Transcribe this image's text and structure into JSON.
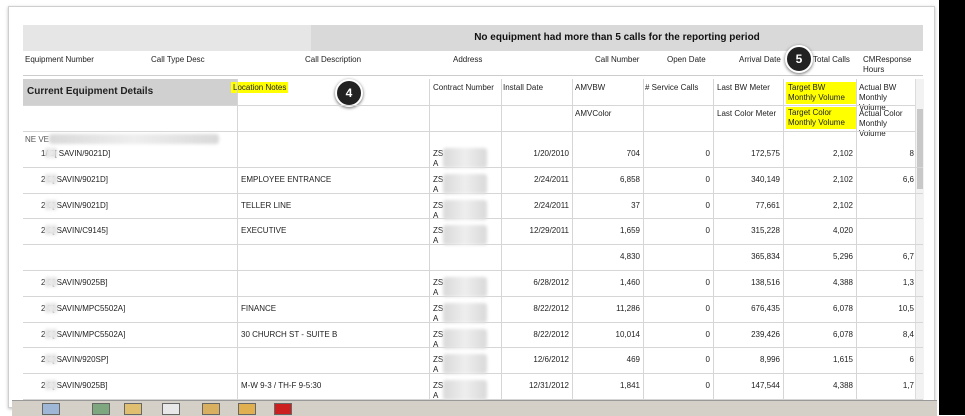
{
  "banner": {
    "message": "No equipment had more than 5 calls for the reporting period"
  },
  "call_columns": [
    "Equipment Number",
    "Call Type Desc",
    "Call Description",
    "Address",
    "Call Number",
    "Open Date",
    "Arrival Date",
    "Total Calls",
    "CMResponse Hours"
  ],
  "section": {
    "title": "Current Equipment Details"
  },
  "headers": {
    "location_notes": "Location Notes",
    "contract_number": "Contract Number",
    "install_date": "Install Date",
    "amv_bw": "AMVBW",
    "amv_color": "AMVColor",
    "service_calls": "# Service Calls",
    "last_bw": "Last BW Meter",
    "last_color": "Last Color Meter",
    "target_bw": "Target BW Monthly Volume",
    "target_color": "Target Color Monthly Volume",
    "actual_bw": "Actual BW Monthly Volume",
    "actual_color": "Actual Color Monthly Volume"
  },
  "badges": {
    "b4": "4",
    "b5": "5"
  },
  "address_group": "NE                                    VE",
  "rows": [
    {
      "equip": "1/   5[ SAVIN/9021D]",
      "notes": "",
      "contract": "ZS\nA",
      "install": "1/20/2010",
      "amv": "704",
      "calls": "0",
      "last_bw": "172,575",
      "target": "2,102",
      "actual": "8"
    },
    {
      "equip": "2   5[ SAVIN/9021D]",
      "notes": "EMPLOYEE ENTRANCE",
      "contract": "ZS\nA",
      "install": "2/24/2011",
      "amv": "6,858",
      "calls": "0",
      "last_bw": "340,149",
      "target": "2,102",
      "actual": "6,6"
    },
    {
      "equip": "2   6[ SAVIN/9021D]",
      "notes": "TELLER LINE",
      "contract": "ZS\nA",
      "install": "2/24/2011",
      "amv": "37",
      "calls": "0",
      "last_bw": "77,661",
      "target": "2,102",
      "actual": ""
    },
    {
      "equip": "2   1[ SAVIN/C9145]",
      "notes": "EXECUTIVE",
      "contract": "ZS\nA",
      "install": "12/29/2011",
      "amv": "1,659",
      "calls": "0",
      "last_bw": "315,228",
      "target": "4,020",
      "actual": ""
    },
    {
      "equip": "",
      "notes": "",
      "contract": "",
      "install": "",
      "amv": "4,830",
      "calls": "",
      "last_bw": "365,834",
      "target": "5,296",
      "actual": "6,7"
    },
    {
      "equip": "2   9[ SAVIN/9025B]",
      "notes": "",
      "contract": "ZS\nA",
      "install": "6/28/2012",
      "amv": "1,460",
      "calls": "0",
      "last_bw": "138,516",
      "target": "4,388",
      "actual": "1,3"
    },
    {
      "equip": "2   7[ SAVIN/MPC5502A]",
      "notes": "FINANCE",
      "contract": "ZS\nA",
      "install": "8/22/2012",
      "amv": "11,286",
      "calls": "0",
      "last_bw": "676,435",
      "target": "6,078",
      "actual": "10,5"
    },
    {
      "equip": "2   9[ SAVIN/MPC5502A]",
      "notes": "30 CHURCH ST - SUITE B",
      "contract": "ZS\nA",
      "install": "8/22/2012",
      "amv": "10,014",
      "calls": "0",
      "last_bw": "239,426",
      "target": "6,078",
      "actual": "8,4"
    },
    {
      "equip": "2   2[ SAVIN/920SP]",
      "notes": "",
      "contract": "ZS\nA",
      "install": "12/6/2012",
      "amv": "469",
      "calls": "0",
      "last_bw": "8,996",
      "target": "1,615",
      "actual": "6"
    },
    {
      "equip": "2   5[ SAVIN/9025B]",
      "notes": "M-W 9-3 / TH-F 9-5:30",
      "contract": "ZS\nA",
      "install": "12/31/2012",
      "amv": "1,841",
      "calls": "0",
      "last_bw": "147,544",
      "target": "4,388",
      "actual": "1,7"
    }
  ]
}
